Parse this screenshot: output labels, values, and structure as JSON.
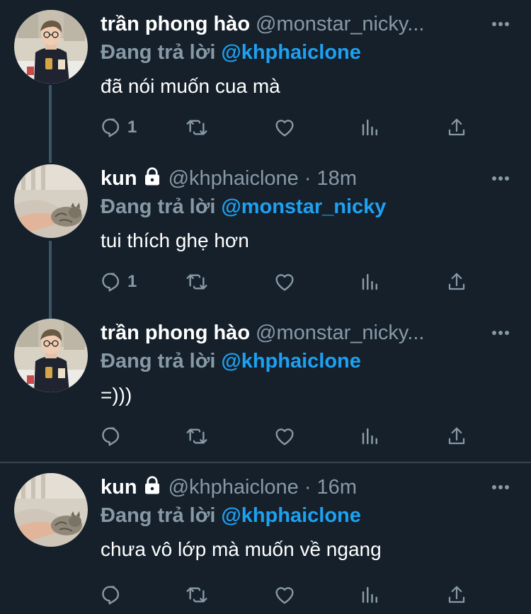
{
  "tweets": [
    {
      "display_name": "trần phong hào",
      "handle_meta": "@monstar_nicky...",
      "locked": false,
      "reply_label": "Đang trả lời",
      "reply_mention": "@khphaiclone",
      "text": "đã nói muốn cua mà",
      "reply_count": "1",
      "avatar": "man-with-glasses-avatar"
    },
    {
      "display_name": "kun",
      "handle_meta": "@khphaiclone · 18m",
      "locked": true,
      "reply_label": "Đang trả lời",
      "reply_mention": "@monstar_nicky",
      "text": "tui thích ghẹ hơn",
      "reply_count": "1",
      "avatar": "cat-avatar"
    },
    {
      "display_name": "trần phong hào",
      "handle_meta": "@monstar_nicky...",
      "locked": false,
      "reply_label": "Đang trả lời",
      "reply_mention": "@khphaiclone",
      "text": "=)))",
      "reply_count": "",
      "avatar": "man-with-glasses-avatar"
    },
    {
      "display_name": "kun",
      "handle_meta": "@khphaiclone · 16m",
      "locked": true,
      "reply_label": "Đang trả lời",
      "reply_mention": "@khphaiclone",
      "text": "chưa vô lớp mà muốn về ngang",
      "reply_count": "",
      "avatar": "cat-avatar"
    }
  ],
  "icons": {
    "reply": "reply-icon",
    "retweet": "retweet-icon",
    "like": "heart-icon",
    "analytics": "analytics-icon",
    "share": "share-icon",
    "more": "more-icon",
    "lock": "lock-icon"
  },
  "colors": {
    "background": "#15202b",
    "secondary_text": "#8899a6",
    "mention": "#1da1f2",
    "divider": "#38444d",
    "thread_line": "#3d5466"
  }
}
